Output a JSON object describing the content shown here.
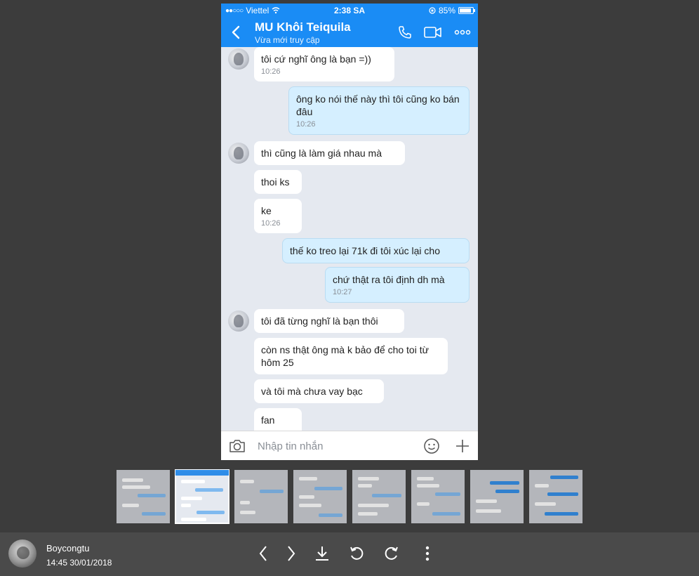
{
  "status_bar": {
    "carrier": "Viettel",
    "time": "2:38 SA",
    "battery": "85%"
  },
  "chat": {
    "name": "MU Khôi Teiquila",
    "status": "Vừa mới truy cập"
  },
  "messages": [
    {
      "text": "tôi cứ nghĩ ông là bạn =))",
      "time": "10:26"
    },
    {
      "text": "ông ko nói thế này thì tôi cũng ko bán đâu",
      "time": "10:26"
    },
    {
      "text": "thì cũng là làm giá nhau mà"
    },
    {
      "text": "thoi ks"
    },
    {
      "text": "ke",
      "time": "10:26"
    },
    {
      "text": "thế ko treo lại 71k đi tôi xúc lại cho"
    },
    {
      "text": "chứ thật ra tôi định dh mà",
      "time": "10:27"
    },
    {
      "text": "tôi đã từng nghĩ là bạn thôi"
    },
    {
      "text": "còn ns thật ông mà k bảo để cho toi từ hôm 25"
    },
    {
      "text": "và tôi mà chưa vay bạc"
    },
    {
      "text": "fan"
    }
  ],
  "input": {
    "placeholder": "Nhập tin nhắn"
  },
  "footer": {
    "user": "Boycongtu",
    "datetime": "14:45 30/01/2018"
  },
  "colors": {
    "accent": "#1a8cf5",
    "incoming_bubble": "#ffffff",
    "outgoing_bubble": "#d5efff",
    "background": "#3c3c3c"
  },
  "icons": [
    "back-icon",
    "phone-icon",
    "video-icon",
    "more-icon",
    "camera-icon",
    "emoji-icon",
    "plus-icon",
    "chevron-left-icon",
    "chevron-right-icon",
    "download-icon",
    "rotate-left-icon",
    "rotate-right-icon",
    "more-vertical-icon"
  ]
}
